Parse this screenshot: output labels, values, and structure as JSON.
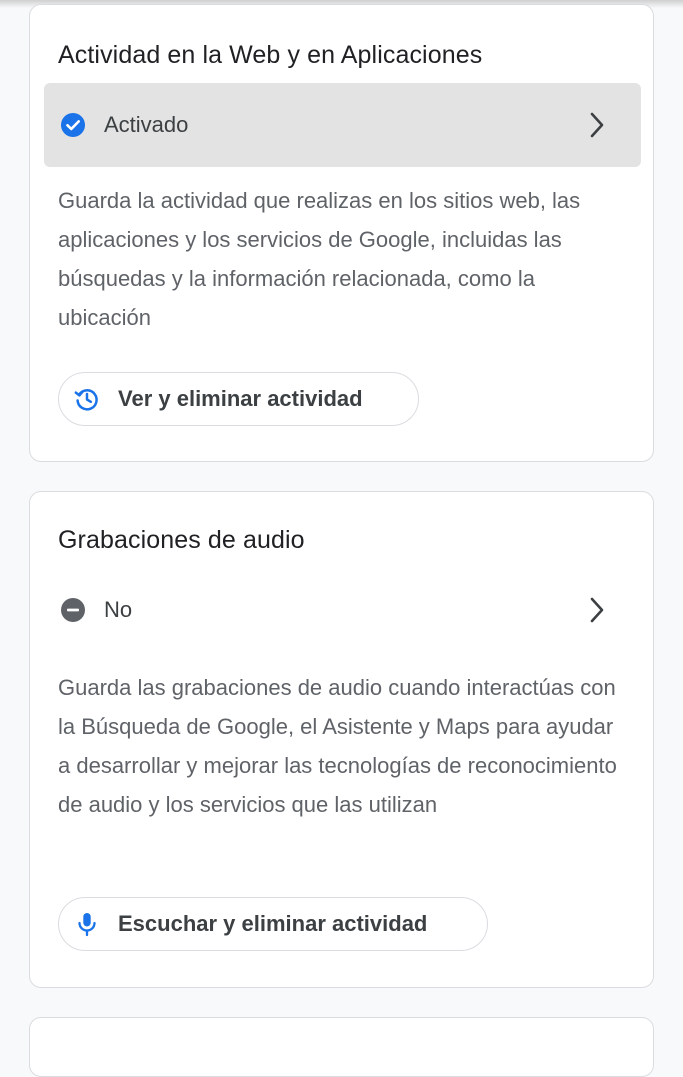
{
  "colors": {
    "accent_blue": "#1a73e8",
    "status_off": "#5f6368",
    "selected_row_bg": "#e3e3e3",
    "description_text": "#5f6368"
  },
  "sections": [
    {
      "title": "Actividad en la Web y en Aplicaciones",
      "status": {
        "icon": "check-circle-icon",
        "label": "Activado"
      },
      "description": "Guarda la actividad que realizas en los sitios web, las aplicaciones y los servicios de Google, incluidas las búsquedas y la información relacionada, como la ubicación",
      "action": {
        "icon": "history-icon",
        "label": "Ver y eliminar actividad"
      }
    },
    {
      "title": "Grabaciones de audio",
      "status": {
        "icon": "minus-circle-icon",
        "label": "No"
      },
      "description": "Guarda las grabaciones de audio cuando interactúas con la Búsqueda de Google, el Asistente y Maps para ayudar a desarrollar y mejorar las tecnologías de reconocimiento de audio y los servicios que las utilizan",
      "action": {
        "icon": "microphone-icon",
        "label": "Escuchar y eliminar actividad"
      }
    }
  ]
}
